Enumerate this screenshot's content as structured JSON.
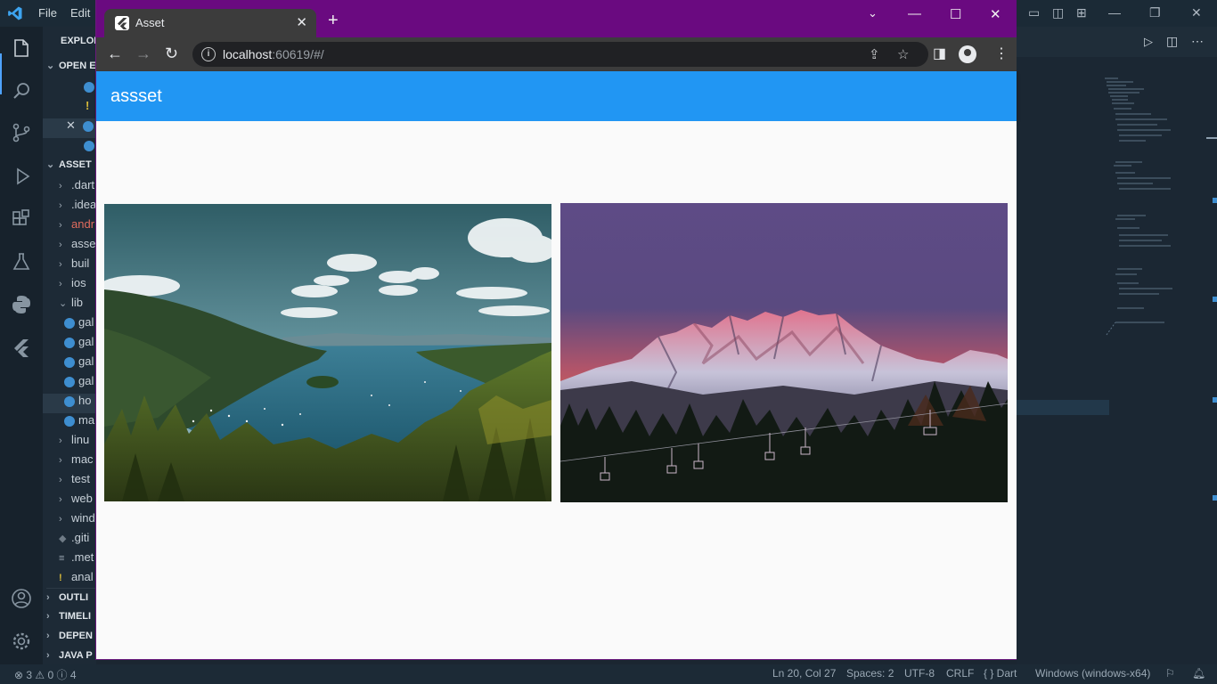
{
  "vscode": {
    "menu": [
      "File",
      "Edit"
    ],
    "sidebar": {
      "explorer_label": "EXPLOR",
      "open_editors_label": "OPEN E",
      "project_label": "ASSET",
      "items": [
        ".dart",
        ".idea",
        "andr",
        "asse",
        "buil",
        "ios",
        "lib",
        "gal",
        "gal",
        "gal",
        "gal",
        "ho",
        "ma",
        "linu",
        "mac",
        "test",
        "web",
        "wind",
        ".giti",
        ".met",
        "anal"
      ],
      "outline_label": "OUTLI",
      "timeline_label": "TIMELI",
      "dependencies_label": "DEPEN",
      "java_label": "JAVA P"
    },
    "status": {
      "problems": "⊗ 3 ⚠ 0 ⓘ 4",
      "position": "Ln 20, Col 27",
      "spaces": "Spaces: 2",
      "encoding": "UTF-8",
      "eol": "CRLF",
      "language": "{ } Dart",
      "platform": "Windows (windows-x64)"
    }
  },
  "browser": {
    "tab_title": "Asset",
    "url_host": "localhost",
    "url_rest": ":60619/#/"
  },
  "app": {
    "title": "assset",
    "images": [
      {
        "name": "lake-forest-image",
        "description_icon": "landscape"
      },
      {
        "name": "mountain-sunset-image",
        "description_icon": "landscape"
      }
    ]
  },
  "colors": {
    "appbar": "#2196f3",
    "chrome_frame": "#6a0a80",
    "chrome_toolbar": "#3c3c3c"
  }
}
